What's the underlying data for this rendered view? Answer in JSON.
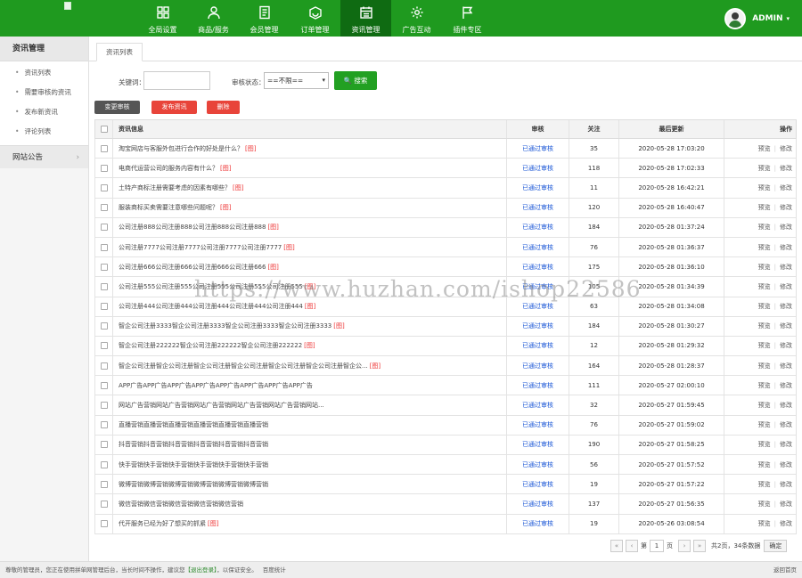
{
  "nav": {
    "items": [
      {
        "label": "全局设置",
        "icon": "grid-icon"
      },
      {
        "label": "商品/服务",
        "icon": "user-icon"
      },
      {
        "label": "会员管理",
        "icon": "document-icon"
      },
      {
        "label": "订单管理",
        "icon": "box-icon"
      },
      {
        "label": "资讯管理",
        "icon": "calendar-icon",
        "active": true
      },
      {
        "label": "广告互动",
        "icon": "gear-icon"
      },
      {
        "label": "插件专区",
        "icon": "flag-icon"
      }
    ]
  },
  "user": {
    "name": "ADMIN",
    "caret": "▾"
  },
  "sidebar": {
    "title": "资讯管理",
    "items": [
      {
        "label": "资讯列表"
      },
      {
        "label": "需要审核的资讯"
      },
      {
        "label": "发布新资讯"
      },
      {
        "label": "评论列表"
      }
    ],
    "section": {
      "label": "网站公告",
      "arrow": "›"
    }
  },
  "tab": {
    "label": "资讯列表"
  },
  "search": {
    "keyword_label": "关键词：",
    "keyword_value": "",
    "status_label": "审核状态：",
    "status_selected": "==不限==",
    "search_button": "搜索"
  },
  "actions": {
    "change_audit": "变更审核",
    "publish": "发布资讯",
    "delete": "删除"
  },
  "table": {
    "headers": {
      "title": "资讯信息",
      "status": "审核",
      "views": "关注",
      "time": "最后更新",
      "ops": "操作"
    },
    "op_preview": "预览",
    "op_edit": "修改",
    "op_sep": "|",
    "rows": [
      {
        "title": "淘宝网店与客服外包进行合作的好处是什么？",
        "img": "[图]",
        "status": "已通过审核",
        "views": "35",
        "time": "2020-05-28 17:03:20"
      },
      {
        "title": "电商代运营公司的服务内容有什么？",
        "img": "[图]",
        "status": "已通过审核",
        "views": "118",
        "time": "2020-05-28 17:02:33"
      },
      {
        "title": "土特产商标注册需要考虑的因素有哪些？",
        "img": "[图]",
        "status": "已通过审核",
        "views": "11",
        "time": "2020-05-28 16:42:21"
      },
      {
        "title": "服装商标买卖需要注意哪些问题呢？",
        "img": "[图]",
        "status": "已通过审核",
        "views": "120",
        "time": "2020-05-28 16:40:47"
      },
      {
        "title": "公司注册888公司注册888公司注册888公司注册888",
        "img": "[图]",
        "status": "已通过审核",
        "views": "184",
        "time": "2020-05-28 01:37:24"
      },
      {
        "title": "公司注册7777公司注册7777公司注册7777公司注册7777",
        "img": "[图]",
        "status": "已通过审核",
        "views": "76",
        "time": "2020-05-28 01:36:37"
      },
      {
        "title": "公司注册666公司注册666公司注册666公司注册666",
        "img": "[图]",
        "status": "已通过审核",
        "views": "175",
        "time": "2020-05-28 01:36:10"
      },
      {
        "title": "公司注册555公司注册555公司注册555公司注册555公司注册555",
        "img": "[图]",
        "status": "已通过审核",
        "views": "105",
        "time": "2020-05-28 01:34:39"
      },
      {
        "title": "公司注册444公司注册444公司注册444公司注册444公司注册444",
        "img": "[图]",
        "status": "已通过审核",
        "views": "63",
        "time": "2020-05-28 01:34:08"
      },
      {
        "title": "智企公司注册3333智企公司注册3333智企公司注册3333智企公司注册3333",
        "img": "[图]",
        "status": "已通过审核",
        "views": "184",
        "time": "2020-05-28 01:30:27"
      },
      {
        "title": "智企公司注册222222智企公司注册222222智企公司注册222222",
        "img": "[图]",
        "status": "已通过审核",
        "views": "12",
        "time": "2020-05-28 01:29:32"
      },
      {
        "title": "智企公司注册智企公司注册智企公司注册智企公司注册智企公司注册智企公司注册智企公...",
        "img": "[图]",
        "status": "已通过审核",
        "views": "164",
        "time": "2020-05-28 01:28:37"
      },
      {
        "title": "APP广告APP广告APP广告APP广告APP广告APP广告APP广告APP广告",
        "img": "",
        "status": "已通过审核",
        "views": "111",
        "time": "2020-05-27 02:00:10"
      },
      {
        "title": "网站广告营销网站广告营销网站广告营销网站广告营销网站广告营销网站...",
        "img": "",
        "status": "已通过审核",
        "views": "32",
        "time": "2020-05-27 01:59:45"
      },
      {
        "title": "直播营销直播营销直播营销直播营销直播营销直播营销",
        "img": "",
        "status": "已通过审核",
        "views": "76",
        "time": "2020-05-27 01:59:02"
      },
      {
        "title": "抖音营销抖音营销抖音营销抖音营销抖音营销抖音营销",
        "img": "",
        "status": "已通过审核",
        "views": "190",
        "time": "2020-05-27 01:58:25"
      },
      {
        "title": "快手营销快手营销快手营销快手营销快手营销快手营销",
        "img": "",
        "status": "已通过审核",
        "views": "56",
        "time": "2020-05-27 01:57:52"
      },
      {
        "title": "微博营销微博营销微博营销微博营销微博营销微博营销",
        "img": "",
        "status": "已通过审核",
        "views": "19",
        "time": "2020-05-27 01:57:22"
      },
      {
        "title": "微信营销微信营销微信营销微信营销微信营销",
        "img": "",
        "status": "已通过审核",
        "views": "137",
        "time": "2020-05-27 01:56:35"
      },
      {
        "title": "代开服务已经为好了想买的抓紧",
        "img": "[图]",
        "status": "已通过审核",
        "views": "19",
        "time": "2020-05-26 03:08:54"
      }
    ]
  },
  "pager": {
    "first": "«",
    "prev": "‹",
    "page_prefix": "第",
    "page_value": "1",
    "page_suffix": "页",
    "next": "›",
    "last": "»",
    "summary": "共2页，34条数据",
    "ok": "确定"
  },
  "watermark": "https://www.huzhan.com/ishop22586",
  "footer": {
    "text": "尊敬的管理员，您正在使用拼单网管理后台，当长时间不操作，建议您",
    "logout": "【退出登录】",
    "text2": "，以保证安全。",
    "stat": "百度统计",
    "home": "返回首页"
  },
  "colors": {
    "brand_green": "#1f9a1f",
    "nav_active": "#0f6b12",
    "status_blue": "#1a56d6",
    "danger_red": "#e8443a"
  }
}
